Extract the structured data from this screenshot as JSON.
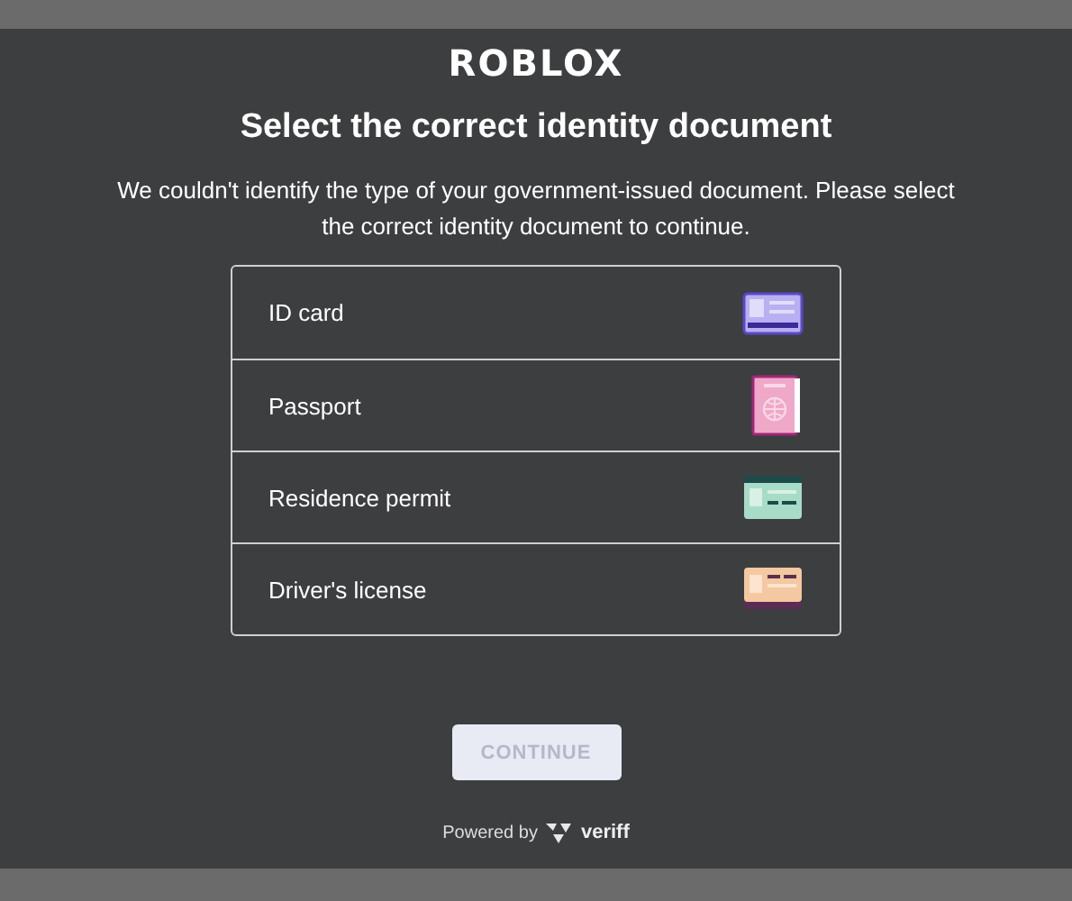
{
  "logo": "ROBLOX",
  "title": "Select the correct identity document",
  "description": "We couldn't identify the type of your government-issued document. Please select the correct identity document to continue.",
  "documents": [
    {
      "label": "ID card",
      "kind": "id"
    },
    {
      "label": "Passport",
      "kind": "passport"
    },
    {
      "label": "Residence permit",
      "kind": "permit"
    },
    {
      "label": "Driver's license",
      "kind": "license"
    }
  ],
  "continue_button": {
    "label": "CONTINUE",
    "disabled": true
  },
  "footer": {
    "text": "Powered by",
    "brand": "veriff"
  }
}
